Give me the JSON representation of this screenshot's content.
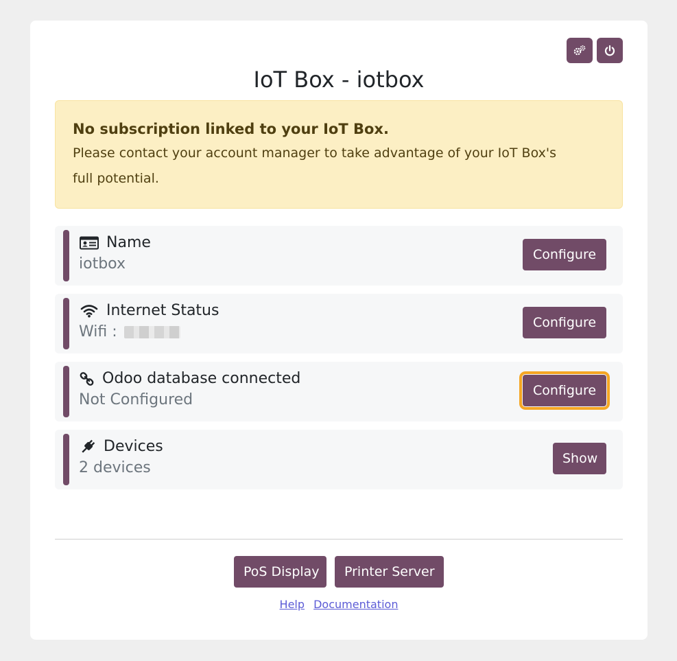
{
  "header": {
    "title": "IoT Box - iotbox"
  },
  "alert": {
    "title": "No subscription linked to your IoT Box.",
    "text": "Please contact your account manager to take advantage of your IoT Box's full potential."
  },
  "rows": [
    {
      "icon": "id-card-icon",
      "label": "Name",
      "value": "iotbox",
      "button": "Configure"
    },
    {
      "icon": "wifi-icon",
      "label": "Internet Status",
      "value": "Wifi :",
      "button": "Configure"
    },
    {
      "icon": "link-icon",
      "label": "Odoo database connected",
      "value": "Not Configured",
      "button": "Configure"
    },
    {
      "icon": "plug-icon",
      "label": "Devices",
      "value": "2 devices",
      "button": "Show"
    }
  ],
  "footer": {
    "buttons": [
      "PoS Display",
      "Printer Server"
    ],
    "links": [
      "Help",
      "Documentation"
    ]
  },
  "colors": {
    "primary": "#714b67",
    "alert_bg": "#fcefc4",
    "focus_outline": "#f5a623"
  }
}
